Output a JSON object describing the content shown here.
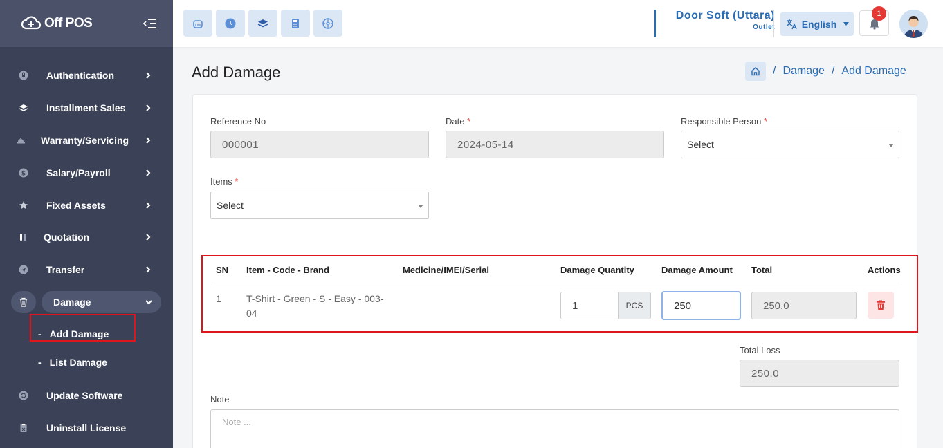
{
  "brand": {
    "name": "Off POS"
  },
  "sidebar": {
    "items": [
      {
        "label": "Authentication",
        "icon": "shield-icon"
      },
      {
        "label": "Installment Sales",
        "icon": "layers-icon"
      },
      {
        "label": "Warranty/Servicing",
        "icon": "servicing-icon"
      },
      {
        "label": "Salary/Payroll",
        "icon": "dollar-icon"
      },
      {
        "label": "Fixed Assets",
        "icon": "assets-icon"
      },
      {
        "label": "Quotation",
        "icon": "quotation-icon"
      },
      {
        "label": "Transfer",
        "icon": "send-icon"
      },
      {
        "label": "Damage",
        "icon": "trash-icon"
      }
    ],
    "sub_items": [
      {
        "label": "Add Damage"
      },
      {
        "label": "List Damage"
      }
    ],
    "bottom_items": [
      {
        "label": "Update Software",
        "icon": "refresh-icon"
      },
      {
        "label": "Uninstall License",
        "icon": "uninstall-icon"
      }
    ]
  },
  "header": {
    "outlet_name": "Door Soft (Uttara)",
    "outlet_type": "Outlet",
    "language": "English",
    "notification_count": "1"
  },
  "page": {
    "title": "Add Damage",
    "breadcrumb": [
      "Damage",
      "Add Damage"
    ]
  },
  "form": {
    "reference_label": "Reference No",
    "reference_value": "000001",
    "date_label": "Date",
    "date_value": "2024-05-14",
    "responsible_label": "Responsible Person",
    "responsible_value": "Select",
    "items_label": "Items",
    "items_value": "Select",
    "required_mark": "*"
  },
  "table": {
    "headers": [
      "SN",
      "Item - Code - Brand",
      "Medicine/IMEI/Serial",
      "Damage Quantity",
      "Damage Amount",
      "Total",
      "Actions"
    ],
    "rows": [
      {
        "sn": "1",
        "item": "T-Shirt - Green - S - Easy - 003-04",
        "serial": "",
        "qty": "1",
        "unit": "PCS",
        "amount": "250",
        "total": "250.0"
      }
    ]
  },
  "summary": {
    "total_loss_label": "Total Loss",
    "total_loss_value": "250.0"
  },
  "note": {
    "label": "Note",
    "placeholder": "Note ..."
  },
  "colors": {
    "sidebar": "#3b4257",
    "accent": "#2b6cb0",
    "highlight": "#e0151b"
  }
}
